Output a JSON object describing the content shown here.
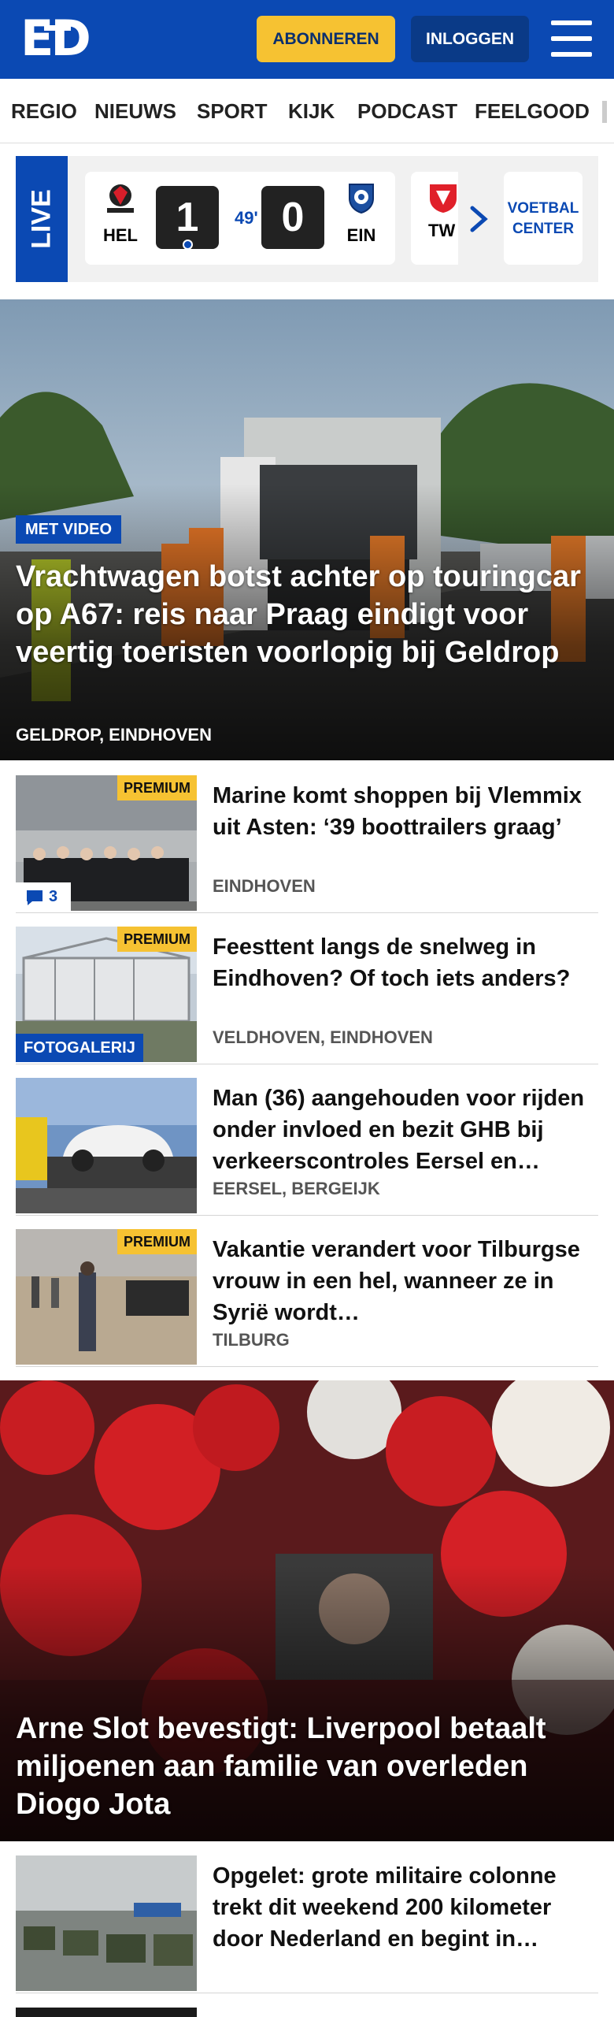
{
  "header": {
    "logo_text": "ED",
    "subscribe_label": "ABONNEREN",
    "login_label": "INLOGGEN",
    "brand_color": "#0b49b3",
    "accent_color": "#f6c232"
  },
  "nav": {
    "items": [
      "REGIO",
      "NIEUWS",
      "SPORT",
      "KIJK",
      "PODCAST",
      "FEELGOOD"
    ]
  },
  "live": {
    "label": "LIVE",
    "match": {
      "home": "HEL",
      "home_score": "1",
      "minute": "49'",
      "away_score": "0",
      "away": "EIN"
    },
    "next_team": "TW",
    "voetbal_center": "VOETBAL CENTER"
  },
  "hero": {
    "badge": "MET VIDEO",
    "title": "Vrachtwagen botst achter op touringcar op A67: reis naar Praag eindigt voor veertig toeristen voorlopig bij Geldrop",
    "location": "GELDROP, EINDHOVEN"
  },
  "articles": [
    {
      "premium": "PREMIUM",
      "comments": "3",
      "title": "Marine komt shoppen bij Vlemmix uit Asten: ‘39 boottrai­lers graag’",
      "location": "EINDHOVEN"
    },
    {
      "premium": "PREMIUM",
      "tag": "FOTOGALERIJ",
      "title": "Feesttent langs de snelweg in Eindhoven? Of toch iets anders?",
      "location": "VELDHOVEN, EINDHOVEN"
    },
    {
      "title": "Man (36) aangehouden voor rijden onder invloed en bezit GHB bij verkeerscontroles Eersel en…",
      "location": "EERSEL, BERGEIJK"
    },
    {
      "premium": "PREMIUM",
      "title": "Vakantie verandert voor Tilburgse vrouw in een hel, wanneer ze in Syrië wordt…",
      "location": "TILBURG"
    }
  ],
  "hero2": {
    "title": "Arne Slot bevestigt: Liverpool betaalt miljoenen aan familie van overleden Diogo Jota"
  },
  "article5": {
    "title": "Opgelet: grote militaire colonne trekt dit weekend 200 kilometer door Nederland en begint in…"
  }
}
